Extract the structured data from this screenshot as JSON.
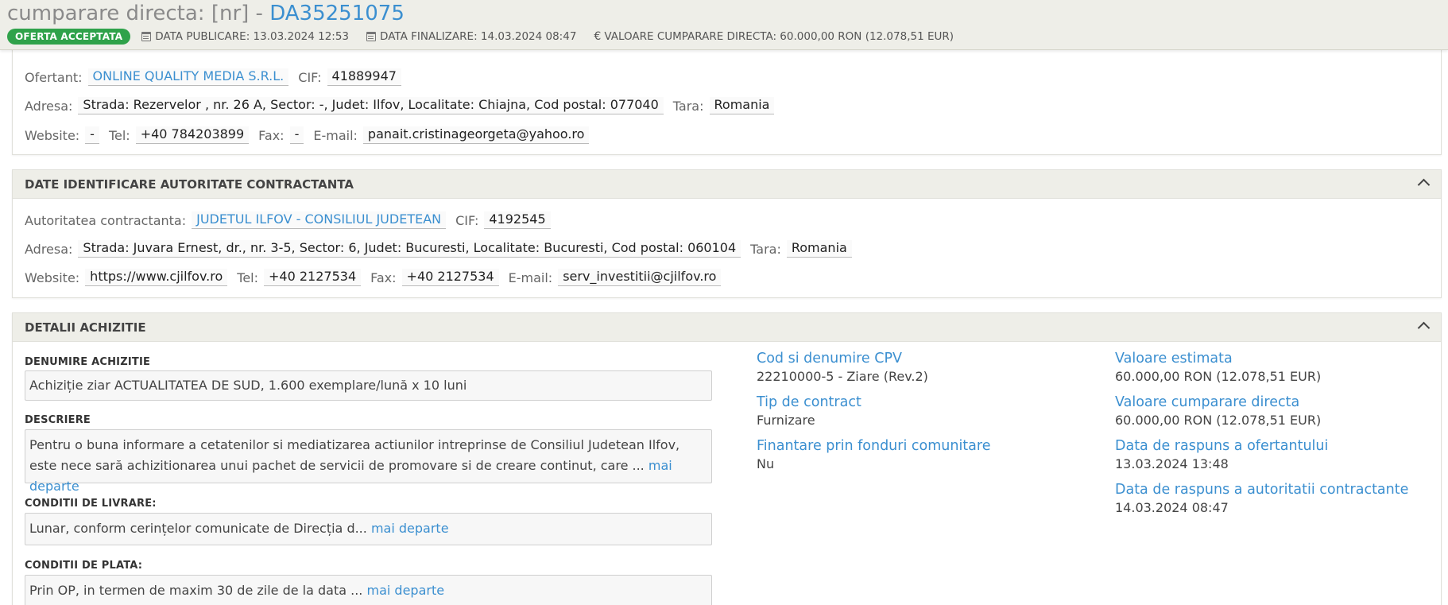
{
  "header": {
    "title_prefix": "cumparare directa: [nr] - ",
    "title_code": "DA35251075",
    "status_badge": "OFERTA ACCEPTATA",
    "data_publicare": "DATA PUBLICARE: 13.03.2024 12:53",
    "data_finalizare": "DATA FINALIZARE: 14.03.2024 08:47",
    "valoare": "VALOARE CUMPARARE DIRECTA: 60.000,00  RON (12.078,51  EUR)",
    "icons": {
      "calendar": "calendar-icon",
      "euro": "€"
    }
  },
  "ofertant": {
    "ofertant_label": "Ofertant:",
    "ofertant_value": "ONLINE QUALITY MEDIA S.R.L.",
    "cif_label": "CIF:",
    "cif_value": "41889947",
    "adresa_label": "Adresa:",
    "adresa_value": "Strada: Rezervelor , nr. 26 A, Sector: -, Judet: Ilfov, Localitate: Chiajna, Cod postal: 077040",
    "tara_label": "Tara:",
    "tara_value": "Romania",
    "website_label": "Website:",
    "website_value": "-",
    "tel_label": "Tel:",
    "tel_value": "+40 784203899",
    "fax_label": "Fax:",
    "fax_value": "-",
    "email_label": "E-mail:",
    "email_value": "panait.cristinageorgeta@yahoo.ro"
  },
  "autoritate": {
    "section_title": "DATE IDENTIFICARE AUTORITATE CONTRACTANTA",
    "autoritate_label": "Autoritatea contractanta:",
    "autoritate_value": "JUDETUL ILFOV - CONSILIUL JUDETEAN",
    "cif_label": "CIF:",
    "cif_value": "4192545",
    "adresa_label": "Adresa:",
    "adresa_value": "Strada: Juvara Ernest, dr., nr. 3-5, Sector: 6, Judet: Bucuresti, Localitate: Bucuresti, Cod postal: 060104",
    "tara_label": "Tara:",
    "tara_value": "Romania",
    "website_label": "Website:",
    "website_value": "https://www.cjilfov.ro",
    "tel_label": "Tel:",
    "tel_value": "+40 2127534",
    "fax_label": "Fax:",
    "fax_value": "+40 2127534",
    "email_label": "E-mail:",
    "email_value": "serv_investitii@cjilfov.ro"
  },
  "detalii": {
    "section_title": "DETALII ACHIZITIE",
    "denumire_label": "DENUMIRE ACHIZITIE",
    "denumire_value": "Achiziție ziar ACTUALITATEA DE SUD, 1.600 exemplare/lună x 10 luni",
    "descriere_label": "DESCRIERE",
    "descriere_value": "Pentru o buna informare a cetatenilor si mediatizarea actiunilor intreprinse de Consiliul Judetean Ilfov, este nece sară achizitionarea unui pachet de servicii de promovare si de creare continut, care ...",
    "livrare_label": "CONDITII DE LIVRARE:",
    "livrare_value": "Lunar, conform cerințelor comunicate de Direcția d...",
    "plata_label": "CONDITII DE PLATA:",
    "plata_value": "Prin OP, in termen de maxim 30 de zile de la data ...",
    "more_link": "mai departe",
    "cpv_title": "Cod si denumire CPV",
    "cpv_value": "22210000-5 - Ziare (Rev.2)",
    "tip_title": "Tip de contract",
    "tip_value": "Furnizare",
    "finantare_title": "Finantare prin fonduri comunitare",
    "finantare_value": "Nu",
    "estimata_title": "Valoare estimata",
    "estimata_value": "60.000,00  RON (12.078,51  EUR)",
    "cumparare_title": "Valoare cumparare directa",
    "cumparare_value": "60.000,00  RON (12.078,51  EUR)",
    "raspuns_ofertant_title": "Data de raspuns a ofertantului",
    "raspuns_ofertant_value": "13.03.2024 13:48",
    "raspuns_autoritate_title": "Data de raspuns a autoritatii contractante",
    "raspuns_autoritate_value": "14.03.2024 08:47"
  },
  "colors": {
    "accent": "#3b8fd0",
    "badge": "#2fa24a",
    "header_bg": "#eeeee8"
  }
}
